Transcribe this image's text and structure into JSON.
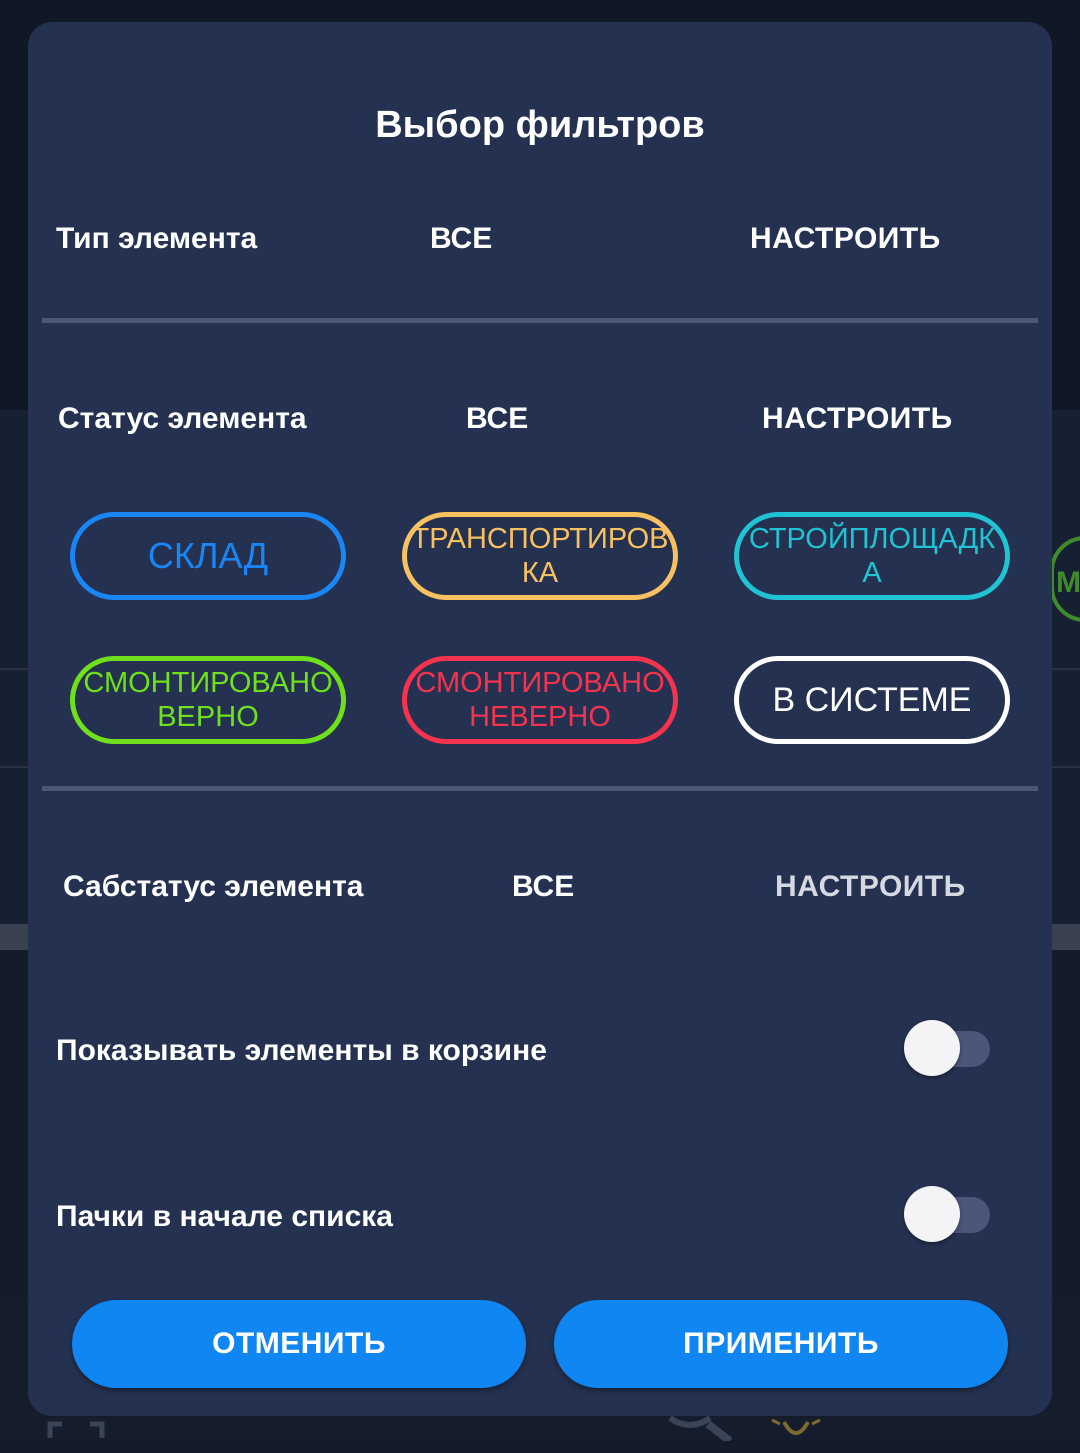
{
  "dialog": {
    "title": "Выбор фильтров",
    "element_type": {
      "label": "Тип элемента",
      "value": "ВСЕ",
      "action": "НАСТРОИТЬ"
    },
    "element_status": {
      "label": "Статус элемента",
      "value": "ВСЕ",
      "action": "НАСТРОИТЬ",
      "chips": [
        {
          "line1": "СКЛАД",
          "line2": "",
          "color": "#1a86f5"
        },
        {
          "line1": "ТРАНСПОРТИРОВ",
          "line2": "КА",
          "color": "#f7c060"
        },
        {
          "line1": "СТРОЙПЛОЩАДК",
          "line2": "А",
          "color": "#1fc3d3"
        },
        {
          "line1": "СМОНТИРОВАНО",
          "line2": "ВЕРНО",
          "color": "#6fe01c"
        },
        {
          "line1": "СМОНТИРОВАНО",
          "line2": "НЕВЕРНО",
          "color": "#f5334f"
        },
        {
          "line1": "В СИСТЕМЕ",
          "line2": "",
          "color": "#ffffff"
        }
      ]
    },
    "element_substatus": {
      "label": "Сабстатус элемента",
      "value": "ВСЕ",
      "action": "НАСТРОИТЬ"
    },
    "show_in_trash": {
      "label": "Показывать элементы в корзине",
      "on": false
    },
    "bundles_first": {
      "label": "Пачки в начале списка",
      "on": false
    },
    "cancel_label": "ОТМЕНИТЬ",
    "apply_label": "ПРИМЕНИТЬ"
  },
  "background": {
    "peek_chip_letter": "М"
  },
  "colors": {
    "dialog_bg": "#253150",
    "button_bg": "#1086f2",
    "divider": "#4b5874"
  }
}
